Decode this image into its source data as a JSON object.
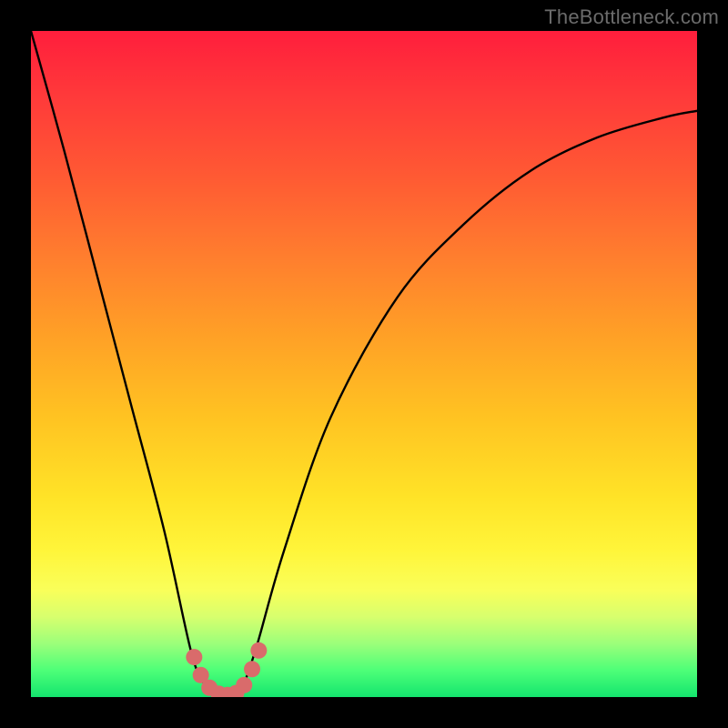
{
  "watermark": "TheBottleneck.com",
  "chart_data": {
    "type": "line",
    "title": "",
    "xlabel": "",
    "ylabel": "",
    "xlim": [
      0,
      100
    ],
    "ylim": [
      0,
      100
    ],
    "grid": false,
    "legend": false,
    "series": [
      {
        "name": "bottleneck-curve",
        "x": [
          0,
          5,
          10,
          15,
          20,
          24,
          26,
          28,
          29,
          30,
          31,
          32,
          34,
          38,
          45,
          55,
          65,
          75,
          85,
          95,
          100
        ],
        "y": [
          100,
          82,
          63,
          44,
          25,
          7,
          2,
          0,
          0,
          0,
          0,
          2,
          8,
          22,
          42,
          60,
          71,
          79,
          84,
          87,
          88
        ]
      }
    ],
    "markers": {
      "name": "min-region-dots",
      "color": "#d96b6b",
      "points": [
        {
          "x": 24.5,
          "y": 6
        },
        {
          "x": 25.5,
          "y": 3.3
        },
        {
          "x": 26.8,
          "y": 1.4
        },
        {
          "x": 28.2,
          "y": 0.5
        },
        {
          "x": 29.5,
          "y": 0.3
        },
        {
          "x": 30.8,
          "y": 0.6
        },
        {
          "x": 32.0,
          "y": 1.8
        },
        {
          "x": 33.2,
          "y": 4.2
        },
        {
          "x": 34.2,
          "y": 7.0
        }
      ]
    }
  }
}
